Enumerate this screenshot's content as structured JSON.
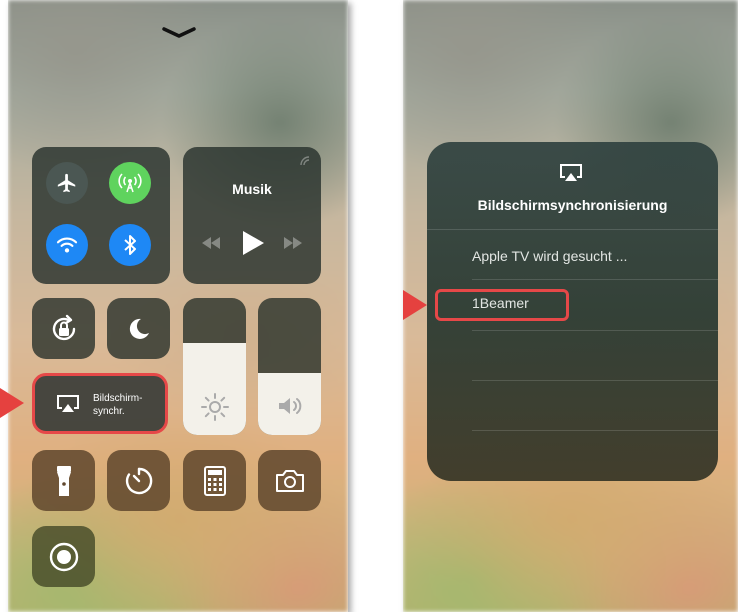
{
  "left_screen": {
    "music": {
      "title": "Musik"
    },
    "screen_mirroring": {
      "label_line1": "Bildschirm-",
      "label_line2": "synchr."
    },
    "connectivity": [
      "airplane-mode",
      "cellular-data",
      "wifi",
      "bluetooth"
    ],
    "sliders": {
      "brightness_level": 0.55,
      "volume_level": 0.45
    },
    "colors": {
      "cellular_green": "#5fd35e",
      "wifi_blue": "#1e88f5",
      "highlight_red": "#e64848"
    }
  },
  "right_screen": {
    "panel": {
      "title": "Bildschirmsynchronisierung",
      "searching_text": "Apple TV wird gesucht ...",
      "devices": [
        "1Beamer"
      ]
    }
  }
}
